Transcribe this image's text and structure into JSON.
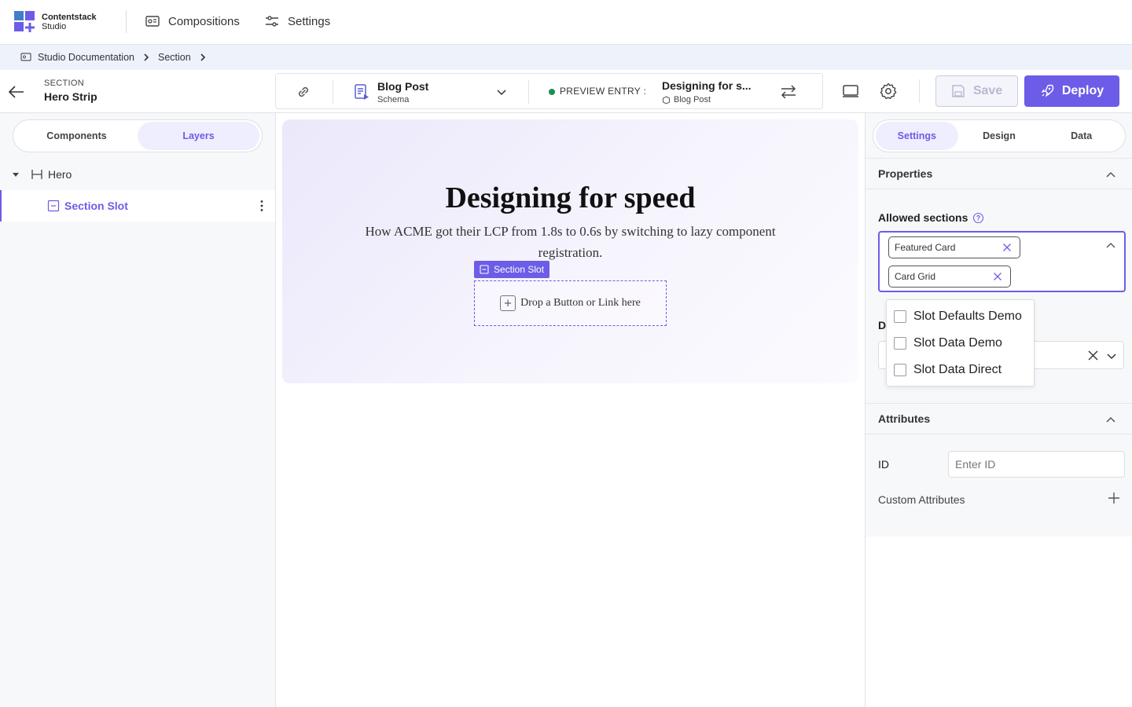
{
  "app": {
    "brand_line1": "Contentstack",
    "brand_line2": "Studio"
  },
  "topnav": {
    "compositions": "Compositions",
    "settings": "Settings"
  },
  "breadcrumb": {
    "items": [
      "Studio Documentation",
      "Section"
    ]
  },
  "section_header": {
    "kind": "SECTION",
    "name": "Hero Strip"
  },
  "toolbar": {
    "schema_title": "Blog Post",
    "schema_sub": "Schema",
    "preview_label": "PREVIEW ENTRY :",
    "entry_title": "Designing for s...",
    "entry_type": "Blog Post",
    "save_label": "Save",
    "deploy_label": "Deploy"
  },
  "left_panel": {
    "tabs": [
      "Components",
      "Layers"
    ],
    "active_tab": "Layers",
    "tree": [
      {
        "label": "Hero"
      },
      {
        "label": "Section Slot"
      }
    ]
  },
  "canvas": {
    "hero_title": "Designing for speed",
    "hero_subtitle": "How ACME got their LCP from 1.8s to 0.6s by switching to lazy component registration.",
    "slot_tag": "Section Slot",
    "slot_placeholder": "Drop a Button or Link here"
  },
  "right_panel": {
    "tabs": [
      "Settings",
      "Design",
      "Data"
    ],
    "active_tab": "Settings",
    "properties_title": "Properties",
    "allowed_sections_label": "Allowed sections",
    "selected_chips": [
      "Featured Card",
      "Card Grid"
    ],
    "dropdown_options": [
      "Slot Defaults Demo",
      "Slot Data Demo",
      "Slot Data Direct"
    ],
    "hidden_label_initial": "D",
    "attributes_title": "Attributes",
    "id_label": "ID",
    "id_placeholder": "Enter ID",
    "custom_attributes_label": "Custom Attributes"
  },
  "colors": {
    "accent": "#6c5ce7",
    "status_dot": "#1a8f5a"
  }
}
